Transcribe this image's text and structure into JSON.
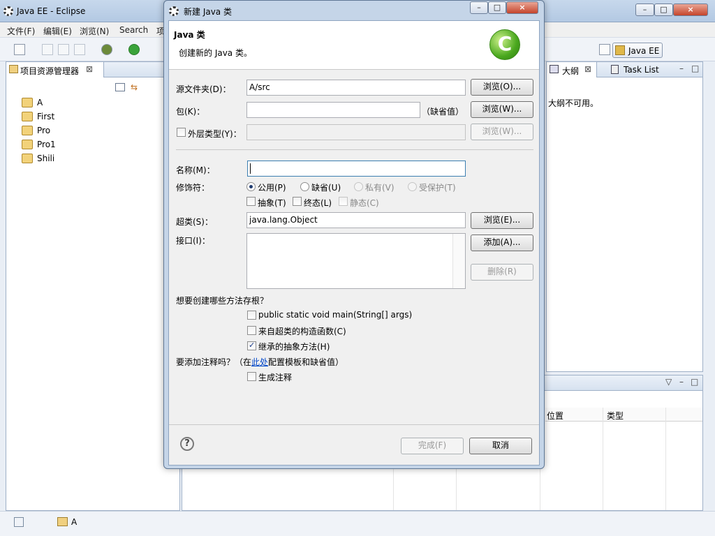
{
  "eclipse": {
    "title": "Java EE  -  Eclipse",
    "menu": [
      "文件(F)",
      "编辑(E)",
      "浏览(N)",
      "Search",
      "项"
    ],
    "left_view_title": "项目资源管理器",
    "projects": [
      "A",
      "First",
      "Pro",
      "Pro1",
      "Shili"
    ],
    "perspective": "Java EE",
    "outline_tab": "大纲",
    "tasklist_tab": "Task List",
    "outline_message": "大纲不可用。",
    "table_headers": [
      "位置",
      "类型"
    ],
    "status_item": "A"
  },
  "dialog": {
    "title": "新建 Java 类",
    "header_title": "Java 类",
    "header_desc": "创建新的 Java 类。",
    "source_folder_label": "源文件夹(D)：",
    "source_folder_value": "A/src",
    "browse_source": "浏览(O)...",
    "package_label": "包(K)：",
    "package_value": "",
    "package_default": "（缺省值）",
    "browse_package": "浏览(W)...",
    "enclosing_label": "外层类型(Y)：",
    "browse_enclosing": "浏览(W)...",
    "name_label": "名称(M)：",
    "name_value": "",
    "modifiers_label": "修饰符：",
    "modifiers": {
      "public": "公用(P)",
      "default": "缺省(U)",
      "private": "私有(V)",
      "protected": "受保护(T)",
      "abstract": "抽象(T)",
      "final": "终态(L)",
      "static": "静态(C)"
    },
    "superclass_label": "超类(S)：",
    "superclass_value": "java.lang.Object",
    "browse_superclass": "浏览(E)...",
    "interfaces_label": "接口(I)：",
    "add_interface": "添加(A)...",
    "remove_interface": "删除(R)",
    "stubs_question": "想要创建哪些方法存根？",
    "stub_main": "public static void main(String[] args)",
    "stub_constructors": "来自超类的构造函数(C)",
    "stub_inherited": "继承的抽象方法(H)",
    "comments_prefix": "要添加注释吗？（在",
    "comments_link": "此处",
    "comments_suffix": "配置模板和缺省值）",
    "generate_comments": "生成注释",
    "finish": "完成(F)",
    "cancel": "取消",
    "help": "?"
  }
}
